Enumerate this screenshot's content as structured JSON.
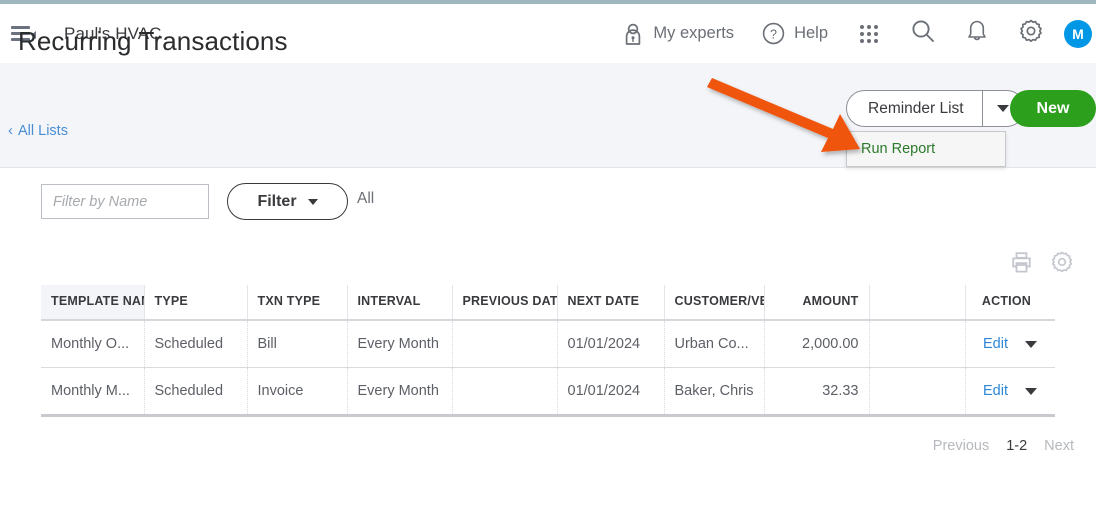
{
  "topbar": {
    "menu_icon": "hamburger-collapse-icon",
    "company": "Paul's HVAC",
    "my_experts": "My experts",
    "my_experts_icon": "expert-person-icon",
    "help": "Help",
    "help_icon": "question-circle-icon",
    "grid_icon": "apps-grid-icon",
    "search_icon": "search-icon",
    "bell_icon": "notification-bell-icon",
    "gear_icon": "settings-gear-icon",
    "avatar_initial": "M",
    "avatar_color": "#0097e6",
    "accent_border": "#9db7bd"
  },
  "page": {
    "title": "Recurring Transactions",
    "breadcrumb": "All Lists",
    "breadcrumb_chevron": "‹",
    "breadcrumb_color": "#4a8fd4"
  },
  "actions": {
    "reminder_list_label": "Reminder List",
    "reminder_caret_icon": "chevron-down-icon",
    "new_label": "New",
    "new_color": "#2ca01c",
    "dropdown": {
      "items": [
        {
          "label": "Run Report",
          "color": "#2c7a2c"
        }
      ]
    }
  },
  "annotation": {
    "type": "arrow",
    "color": "#f0540f",
    "points_to": "Run Report"
  },
  "filters": {
    "name_placeholder": "Filter by Name",
    "name_value": "",
    "filter_label": "Filter",
    "filter_caret_icon": "chevron-down-icon",
    "all_label": "All"
  },
  "table_tools": {
    "print_icon": "printer-icon",
    "settings_icon": "gear-icon"
  },
  "table": {
    "columns": [
      {
        "key": "template_name",
        "label": "TEMPLATE NAME",
        "align": "left"
      },
      {
        "key": "type",
        "label": "TYPE",
        "align": "left"
      },
      {
        "key": "txn_type",
        "label": "TXN TYPE",
        "align": "left"
      },
      {
        "key": "interval",
        "label": "INTERVAL",
        "align": "left"
      },
      {
        "key": "previous_date",
        "label": "PREVIOUS DATE",
        "align": "left"
      },
      {
        "key": "next_date",
        "label": "NEXT DATE",
        "align": "left"
      },
      {
        "key": "customer_vendor",
        "label": "CUSTOMER/VENDOR",
        "align": "left"
      },
      {
        "key": "amount",
        "label": "AMOUNT",
        "align": "right"
      },
      {
        "key": "spacer",
        "label": "",
        "align": "left"
      },
      {
        "key": "action",
        "label": "ACTION",
        "align": "right"
      }
    ],
    "rows": [
      {
        "template_name": "Monthly O...",
        "type": "Scheduled",
        "txn_type": "Bill",
        "interval": "Every Month",
        "previous_date": "",
        "next_date": "01/01/2024",
        "customer_vendor": "Urban Co...",
        "amount": "2,000.00",
        "spacer": "",
        "action": "Edit"
      },
      {
        "template_name": "Monthly M...",
        "type": "Scheduled",
        "txn_type": "Invoice",
        "interval": "Every Month",
        "previous_date": "",
        "next_date": "01/01/2024",
        "customer_vendor": "Baker, Chris",
        "amount": "32.33",
        "spacer": "",
        "action": "Edit"
      }
    ]
  },
  "pagination": {
    "previous": "Previous",
    "range": "1-2",
    "next": "Next"
  }
}
